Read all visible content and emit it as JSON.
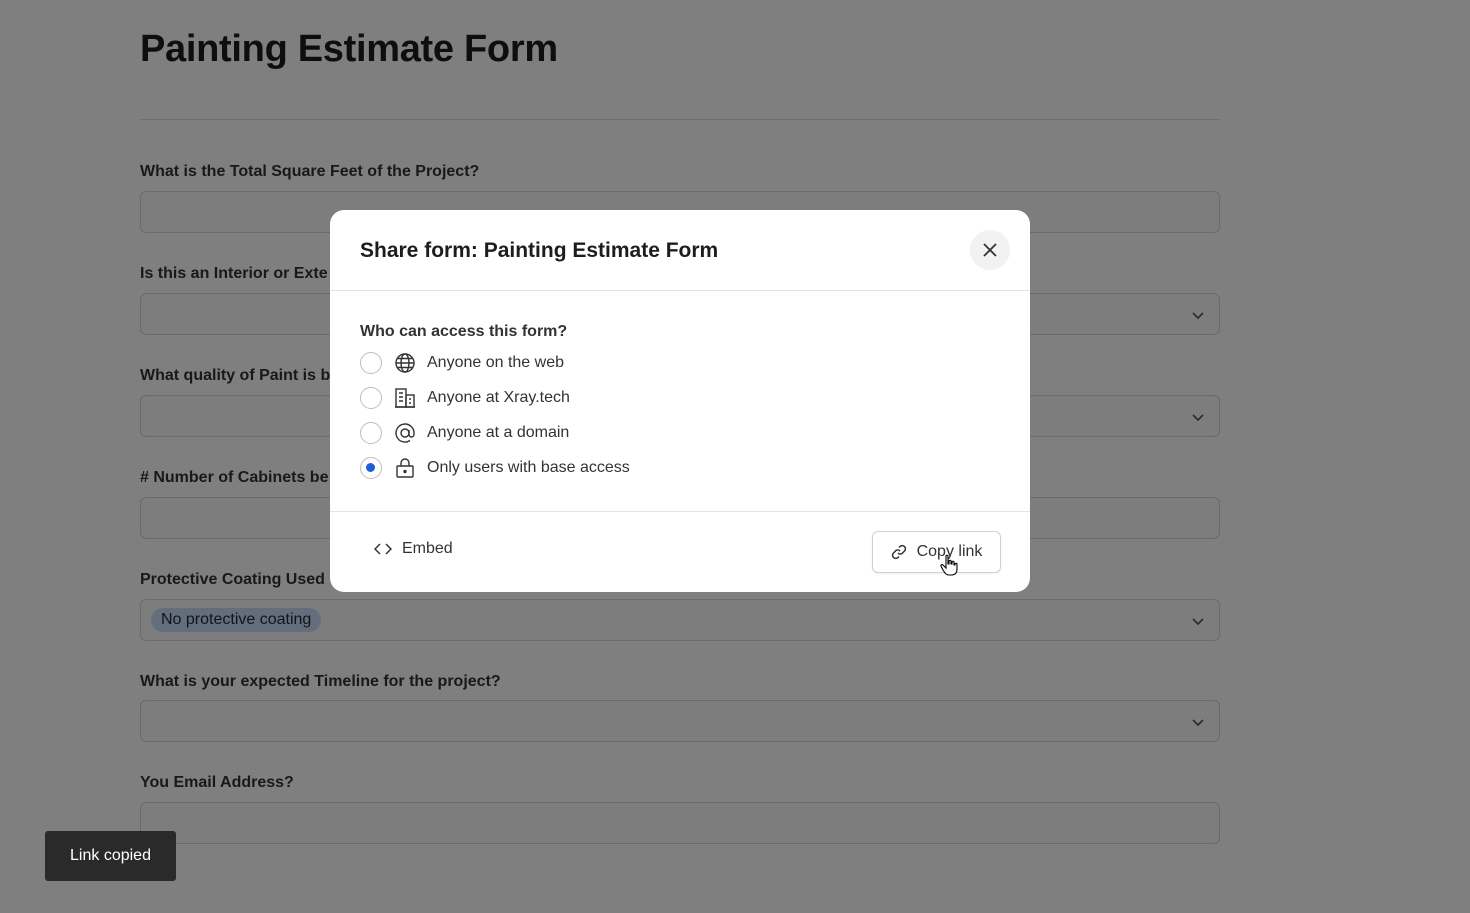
{
  "form": {
    "title": "Painting Estimate Form",
    "fields": [
      {
        "label": "What is the Total Square Feet of the Project?",
        "type": "text",
        "value": ""
      },
      {
        "label": "Is this an Interior or Exte",
        "type": "select",
        "value": ""
      },
      {
        "label": "What quality of Paint is b",
        "type": "select",
        "value": ""
      },
      {
        "label": "# Number of Cabinets be",
        "type": "text",
        "value": ""
      },
      {
        "label": "Protective Coating Used",
        "type": "select",
        "value": "No protective coating"
      },
      {
        "label": "What is your expected Timeline for the project?",
        "type": "select",
        "value": ""
      },
      {
        "label": "You Email Address?",
        "type": "text",
        "value": ""
      }
    ]
  },
  "modal": {
    "title": "Share form: Painting Estimate Form",
    "access_heading": "Who can access this form?",
    "options": [
      {
        "label": "Anyone on the web",
        "icon": "globe-icon",
        "selected": false
      },
      {
        "label": "Anyone at Xray.tech",
        "icon": "building-icon",
        "selected": false
      },
      {
        "label": "Anyone at a domain",
        "icon": "at-sign-icon",
        "selected": false
      },
      {
        "label": "Only users with base access",
        "icon": "lock-icon",
        "selected": true
      }
    ],
    "embed_label": "Embed",
    "copy_link_label": "Copy link"
  },
  "toast": {
    "message": "Link copied"
  },
  "colors": {
    "accent": "#1a5fd6",
    "chip": "#c8dbf8",
    "toast": "#2a2a2a"
  }
}
